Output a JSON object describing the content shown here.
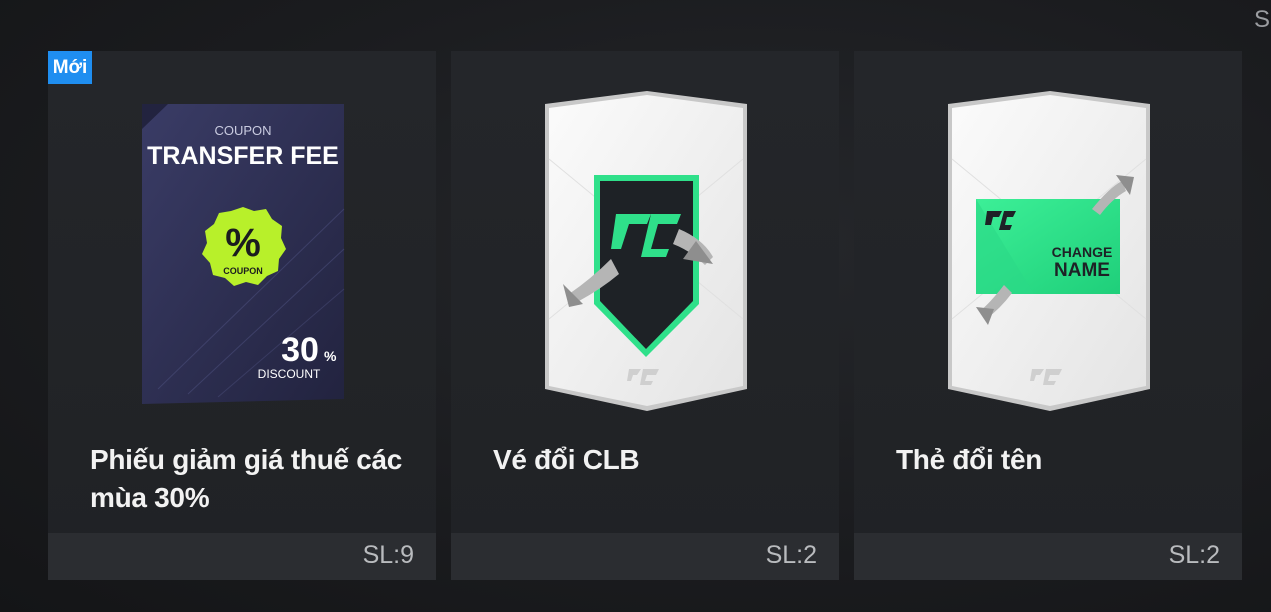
{
  "edge_label": "S",
  "items": [
    {
      "badge": "Mới",
      "art": {
        "kicker": "COUPON",
        "title": "TRANSFER FEE",
        "seal_symbol": "%",
        "seal_text": "COUPON",
        "discount_value": "30",
        "discount_unit": "%",
        "discount_text": "DISCOUNT"
      },
      "name": "Phiếu giảm giá thuế các mùa 30%",
      "quantity": "SL:9"
    },
    {
      "name": "Vé đổi CLB",
      "quantity": "SL:2"
    },
    {
      "art": {
        "line1": "CHANGE",
        "line2": "NAME"
      },
      "name": "Thẻ đổi tên",
      "quantity": "SL:2"
    }
  ],
  "colors": {
    "badge": "#1f8ef0",
    "accent_green": "#2fe08a",
    "seal_green": "#b8f02a",
    "coupon_navy": "#2c2e52"
  }
}
